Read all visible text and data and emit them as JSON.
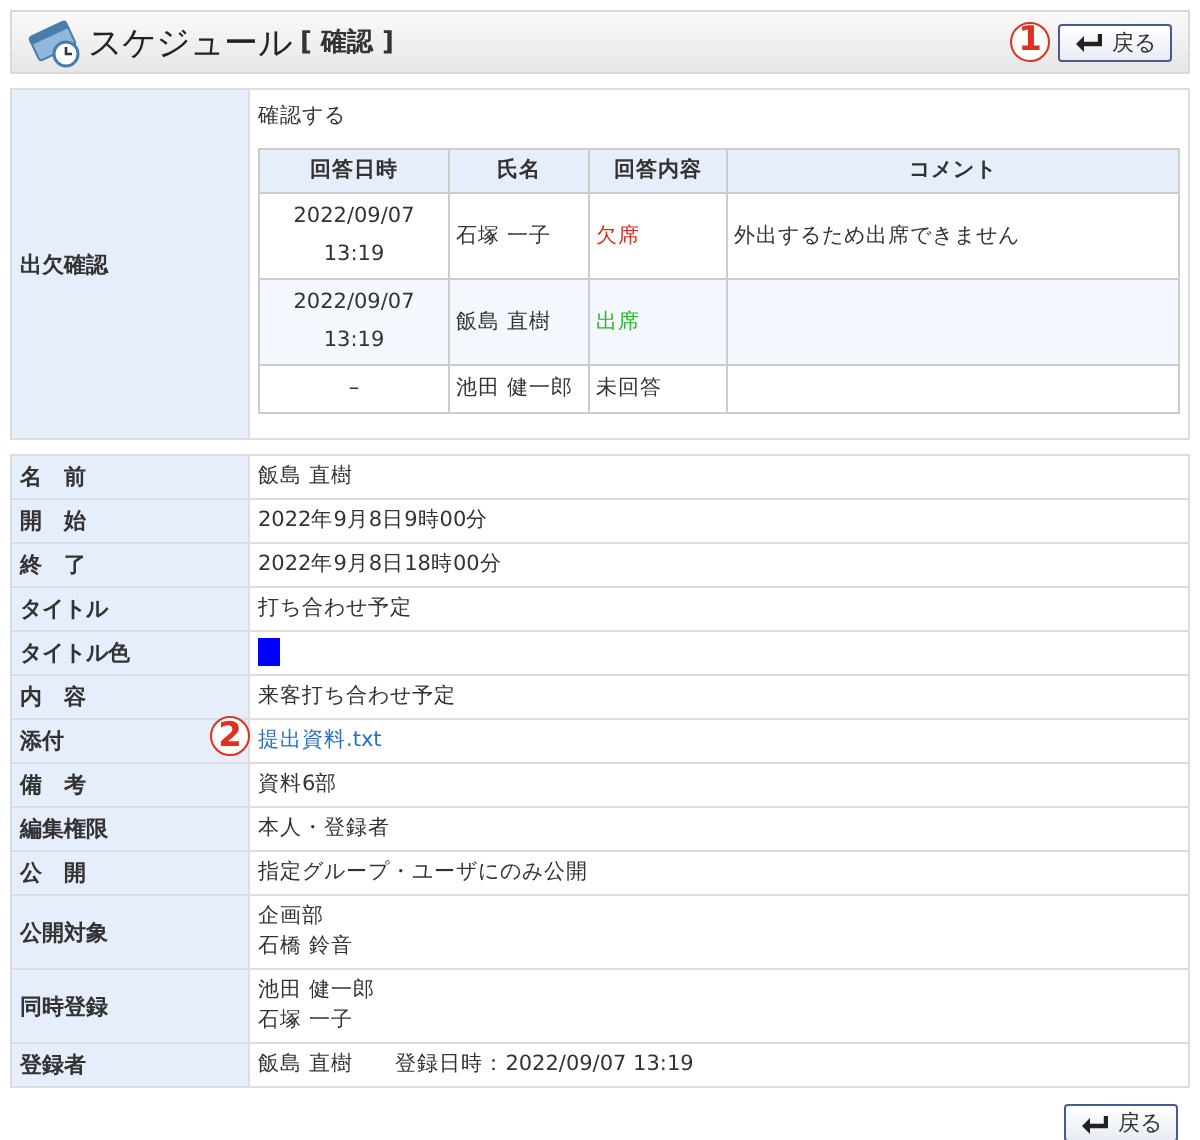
{
  "header": {
    "title": "スケジュール",
    "subtitle": "[ 確認 ]",
    "back_button": {
      "label": "戻る",
      "callout": "1"
    }
  },
  "attendance": {
    "label": "出欠確認",
    "confirm_text": "確認する",
    "columns": [
      "回答日時",
      "氏名",
      "回答内容",
      "コメント"
    ],
    "rows": [
      {
        "time": [
          "2022/09/07",
          "13:19"
        ],
        "name": "石塚 一子",
        "color": "#d03020",
        "response": "欠席",
        "comment": "外出するため出席できません"
      },
      {
        "time": [
          "2022/09/07",
          "13:19"
        ],
        "name": "飯島 直樹",
        "color": "#22bb22",
        "response": "出席",
        "comment": ""
      },
      {
        "time": [
          "–"
        ],
        "name": "池田 健一郎",
        "color": "#333333",
        "response": "未回答",
        "comment": ""
      }
    ]
  },
  "details": [
    {
      "kind": "text",
      "label": "名　前",
      "lines": [
        "飯島 直樹"
      ]
    },
    {
      "kind": "text",
      "label": "開　始",
      "lines": [
        "2022年9月8日9時00分"
      ]
    },
    {
      "kind": "text",
      "label": "終　了",
      "lines": [
        "2022年9月8日18時00分"
      ]
    },
    {
      "kind": "text",
      "label": "タイトル",
      "lines": [
        "打ち合わせ予定"
      ]
    },
    {
      "kind": "color",
      "label": "タイトル色",
      "color": "#0000ff"
    },
    {
      "kind": "text",
      "label": "内　容",
      "lines": [
        "来客打ち合わせ予定"
      ]
    },
    {
      "kind": "link",
      "label": "添付",
      "lines": [
        "提出資料.txt"
      ],
      "callout": "2"
    },
    {
      "kind": "text",
      "label": "備　考",
      "lines": [
        "資料6部"
      ]
    },
    {
      "kind": "text",
      "label": "編集権限",
      "lines": [
        "本人・登録者"
      ]
    },
    {
      "kind": "text",
      "label": "公　開",
      "lines": [
        "指定グループ・ユーザにのみ公開"
      ]
    },
    {
      "kind": "text",
      "label": "公開対象",
      "lines": [
        "企画部",
        "石橋 鈴音"
      ]
    },
    {
      "kind": "text",
      "label": "同時登録",
      "lines": [
        "池田 健一郎",
        "石塚 一子"
      ]
    },
    {
      "kind": "registrant",
      "label": "登録者",
      "lines": [
        "飯島 直樹",
        "登録日時：2022/09/07 13:19"
      ]
    }
  ],
  "footer": {
    "back_button": {
      "label": "戻る"
    }
  }
}
